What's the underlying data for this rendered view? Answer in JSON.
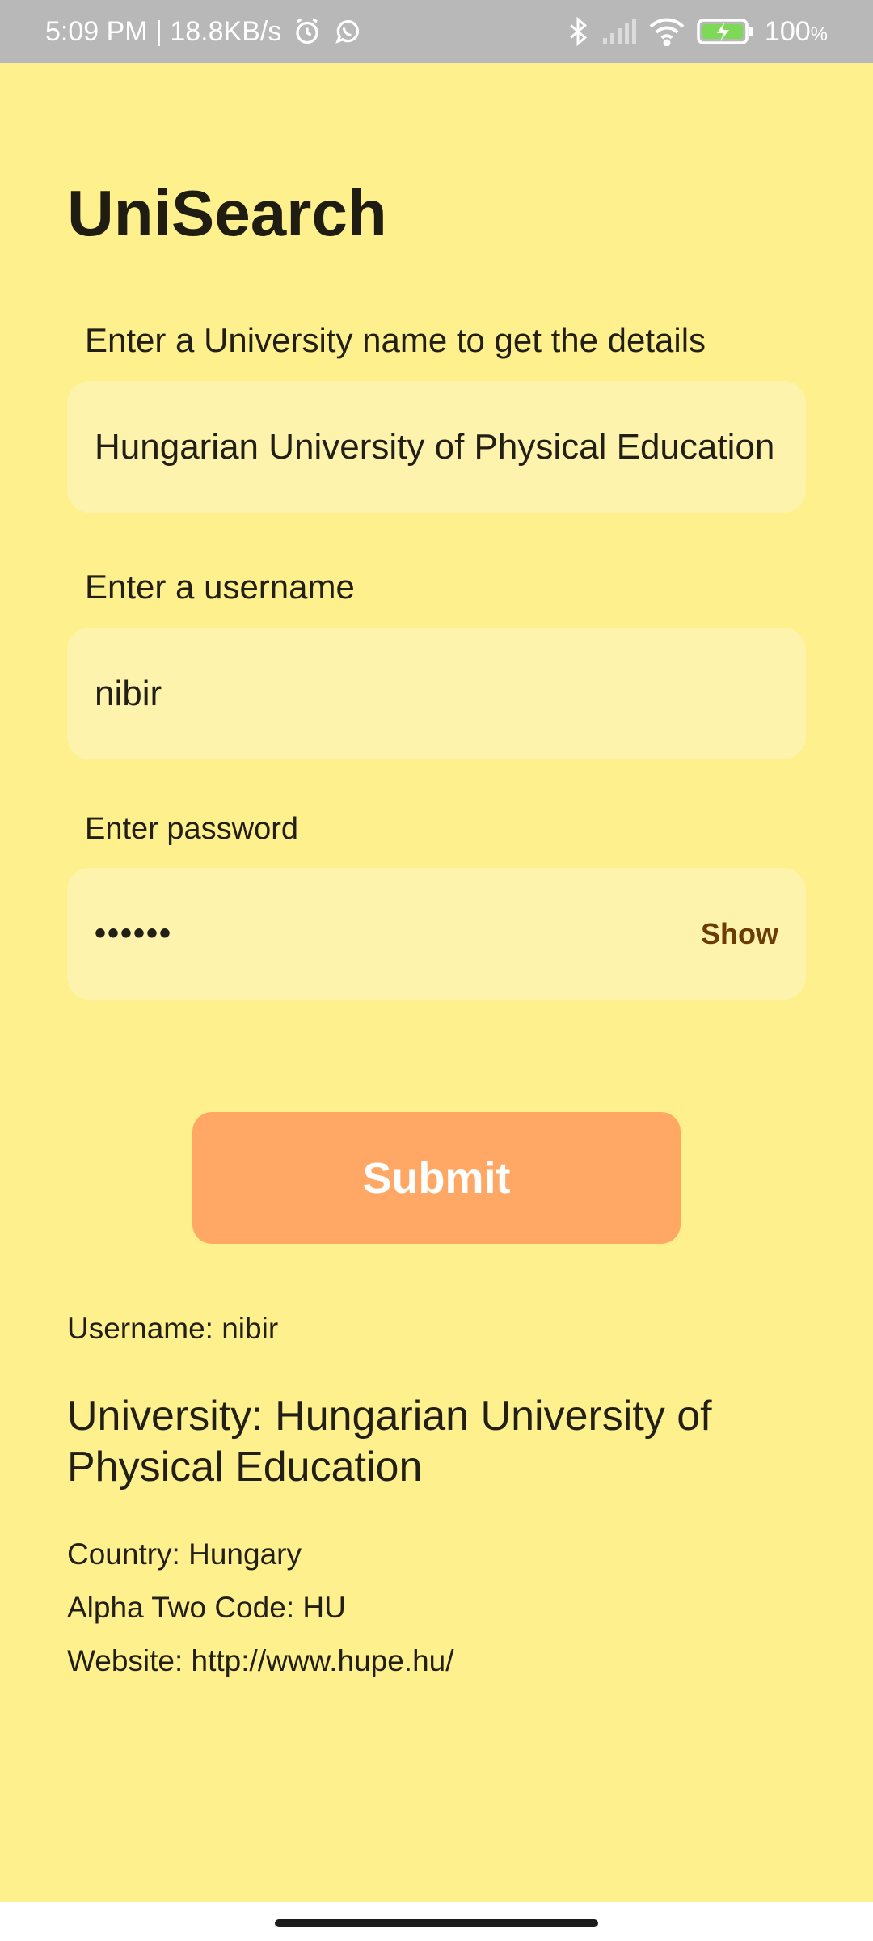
{
  "status_bar": {
    "time_speed": "5:09 PM | 18.8KB/s",
    "battery": "100",
    "battery_unit": "%",
    "icons": [
      "alarm-icon",
      "whatsapp-icon",
      "bluetooth-icon",
      "signal-icon",
      "wifi-icon",
      "battery-charging-icon"
    ]
  },
  "app": {
    "title": "UniSearch"
  },
  "form": {
    "university_label": "Enter a University name to get the details",
    "university_value": "Hungarian University of Physical Education",
    "username_label": "Enter a username",
    "username_value": "nibir",
    "password_label": "Enter password",
    "password_value": "••••••",
    "show_label": "Show",
    "submit_label": "Submit"
  },
  "result": {
    "username": "Username: nibir",
    "university": "University: Hungarian University of Physical Education",
    "country": "Country: Hungary",
    "alpha_two_code": "Alpha Two Code: HU",
    "website": "Website: http://www.hupe.hu/"
  },
  "colors": {
    "background": "#fef08c",
    "field": "#fef3ac",
    "submit": "#ffa866",
    "show_text": "#6b3c06",
    "status_bar": "#b8b8b8"
  }
}
